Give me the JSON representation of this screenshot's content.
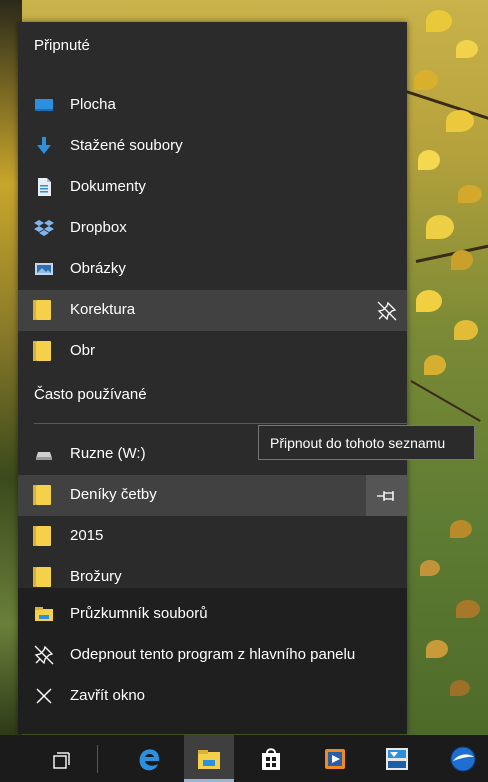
{
  "jumplist": {
    "pinned_header": "Připnuté",
    "pinned_items": [
      {
        "label": "Plocha",
        "icon": "desktop-icon"
      },
      {
        "label": "Stažené soubory",
        "icon": "downloads-icon"
      },
      {
        "label": "Dokumenty",
        "icon": "documents-icon"
      },
      {
        "label": "Dropbox",
        "icon": "dropbox-icon"
      },
      {
        "label": "Obrázky",
        "icon": "pictures-icon"
      },
      {
        "label": "Korektura",
        "icon": "folder-icon"
      },
      {
        "label": "Obr",
        "icon": "folder-icon"
      }
    ],
    "frequent_header": "Často používané",
    "frequent_items": [
      {
        "label": "Ruzne (W:)",
        "icon": "drive-icon"
      },
      {
        "label": "Deníky četby",
        "icon": "folder-icon"
      },
      {
        "label": "2015",
        "icon": "folder-icon"
      },
      {
        "label": "Brožury",
        "icon": "folder-icon"
      }
    ],
    "actions": [
      {
        "label": "Průzkumník souborů",
        "icon": "file-explorer-icon"
      },
      {
        "label": "Odepnout tento program z hlavního panelu",
        "icon": "unpin-icon"
      },
      {
        "label": "Zavřít okno",
        "icon": "close-icon"
      }
    ]
  },
  "tooltip": {
    "text": "Připnout do tohoto seznamu"
  },
  "taskbar": {
    "items": [
      "task-view-icon",
      "edge-icon",
      "file-explorer-icon",
      "store-icon",
      "media-player-icon",
      "app-icon",
      "browser-icon"
    ]
  },
  "colors": {
    "menu_bg": "#2b2b2b",
    "hover_bg": "#414141",
    "folder": "#f5d04a",
    "accent_blue": "#2d8fe0",
    "taskbar_bg": "#1b1b1b"
  }
}
